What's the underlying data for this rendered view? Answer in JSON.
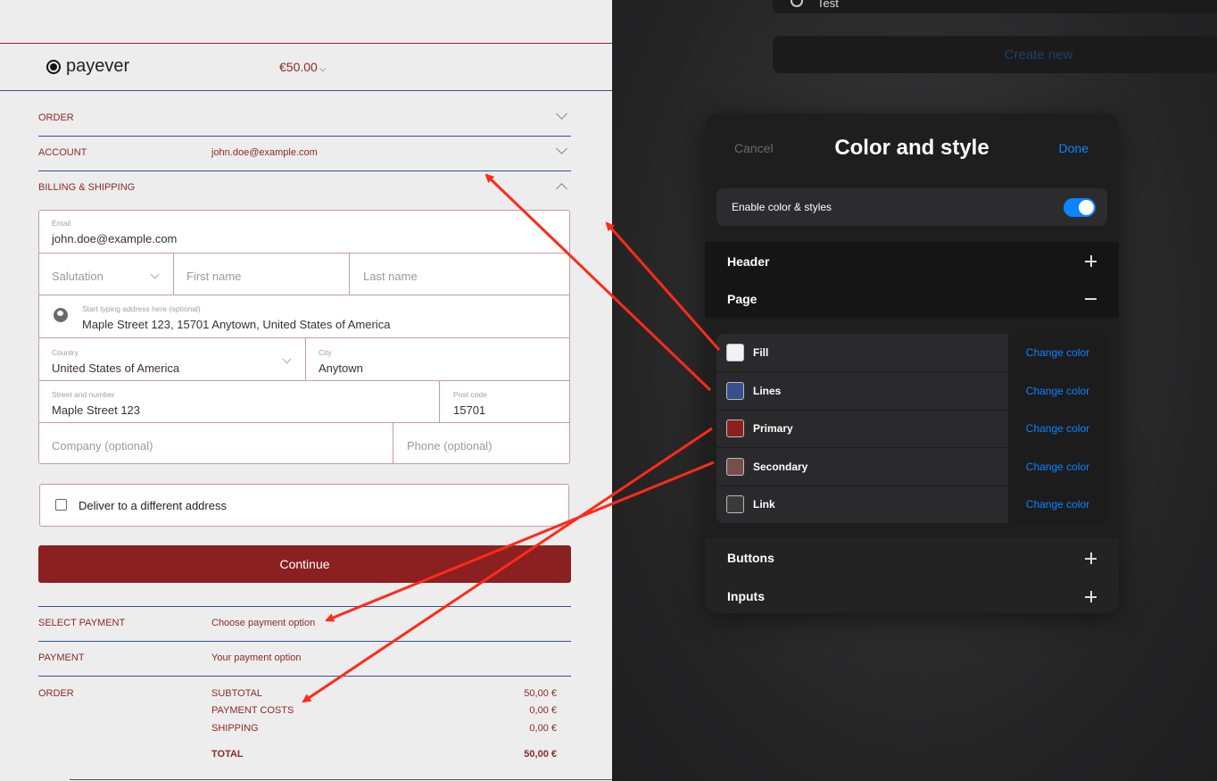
{
  "checkout": {
    "logo_text": "payever",
    "price": "€50.00",
    "sections": {
      "order": "ORDER",
      "account": "ACCOUNT",
      "account_value": "john.doe@example.com",
      "billing": "BILLING & SHIPPING"
    },
    "form": {
      "email_label": "Email",
      "email_value": "john.doe@example.com",
      "salutation_placeholder": "Salutation",
      "first_name_placeholder": "First name",
      "last_name_placeholder": "Last name",
      "address_hint": "Start typing address here (optional)",
      "address_value": "Maple Street 123, 15701 Anytown, United States of America",
      "country_label": "Country",
      "country_value": "United States of America",
      "city_label": "City",
      "city_value": "Anytown",
      "street_label": "Street and number",
      "street_value": "Maple Street 123",
      "postcode_label": "Post code",
      "postcode_value": "15701",
      "company_placeholder": "Company (optional)",
      "phone_placeholder": "Phone (optional)"
    },
    "deliver_label": "Deliver to a different address",
    "continue_label": "Continue",
    "select_payment": {
      "label": "SELECT PAYMENT",
      "value": "Choose payment option"
    },
    "payment": {
      "label": "PAYMENT",
      "value": "Your payment option"
    },
    "order_summary": {
      "label": "ORDER",
      "rows": [
        {
          "name": "SUBTOTAL",
          "amount": "50,00 €"
        },
        {
          "name": "PAYMENT COSTS",
          "amount": "0,00 €"
        },
        {
          "name": "SHIPPING",
          "amount": "0,00 €"
        }
      ],
      "total": {
        "name": "TOTAL",
        "amount": "50,00 €"
      }
    },
    "colors": {
      "primary": "#8b2020",
      "lines": "#34508e",
      "fill": "#ededee"
    }
  },
  "editor": {
    "test_label": "Test",
    "create_new_label": "Create new",
    "panel": {
      "cancel": "Cancel",
      "title": "Color and style",
      "done": "Done",
      "enable_label": "Enable color & styles",
      "enable_on": true,
      "header_label": "Header",
      "page_label": "Page",
      "buttons_label": "Buttons",
      "inputs_label": "Inputs",
      "change_label": "Change color",
      "color_rows": [
        {
          "name": "Fill",
          "color": "#f2f2f2"
        },
        {
          "name": "Lines",
          "color": "#34508e"
        },
        {
          "name": "Primary",
          "color": "#8b2020"
        },
        {
          "name": "Secondary",
          "color": "#7a4c4c"
        },
        {
          "name": "Link",
          "color": "#3a3a3a"
        }
      ]
    },
    "accent": "#0a84ff"
  },
  "annotation_color": "#ff2a1a"
}
